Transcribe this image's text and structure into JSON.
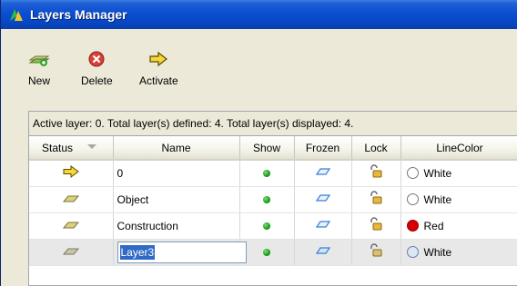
{
  "window": {
    "title": "Layers Manager"
  },
  "toolbar": {
    "new_label": "New",
    "delete_label": "Delete",
    "activate_label": "Activate"
  },
  "status_text": "Active layer: 0. Total layer(s) defined: 4. Total layer(s) displayed: 4.",
  "columns": {
    "status": "Status",
    "name": "Name",
    "show": "Show",
    "frozen": "Frozen",
    "lock": "Lock",
    "linecolor": "LineColor"
  },
  "layers": [
    {
      "status_icon": "active-arrow-icon",
      "name": "0",
      "show": true,
      "frozen": false,
      "locked": false,
      "linecolor": "White",
      "color": "#ffffff"
    },
    {
      "status_icon": "layer-icon",
      "name": "Object",
      "show": true,
      "frozen": false,
      "locked": false,
      "linecolor": "White",
      "color": "#ffffff"
    },
    {
      "status_icon": "layer-icon",
      "name": "Construction",
      "show": true,
      "frozen": false,
      "locked": false,
      "linecolor": "Red",
      "color": "#e00000"
    },
    {
      "status_icon": "layer-icon",
      "name": "Layer3",
      "show": true,
      "frozen": false,
      "locked": false,
      "linecolor": "White",
      "color": "#ffffff",
      "editing": true,
      "selected": true
    }
  ],
  "colors": {
    "title_bar": "#0a4fcf",
    "selection": "#316ac5",
    "show_indicator": "#1a9a1a"
  }
}
